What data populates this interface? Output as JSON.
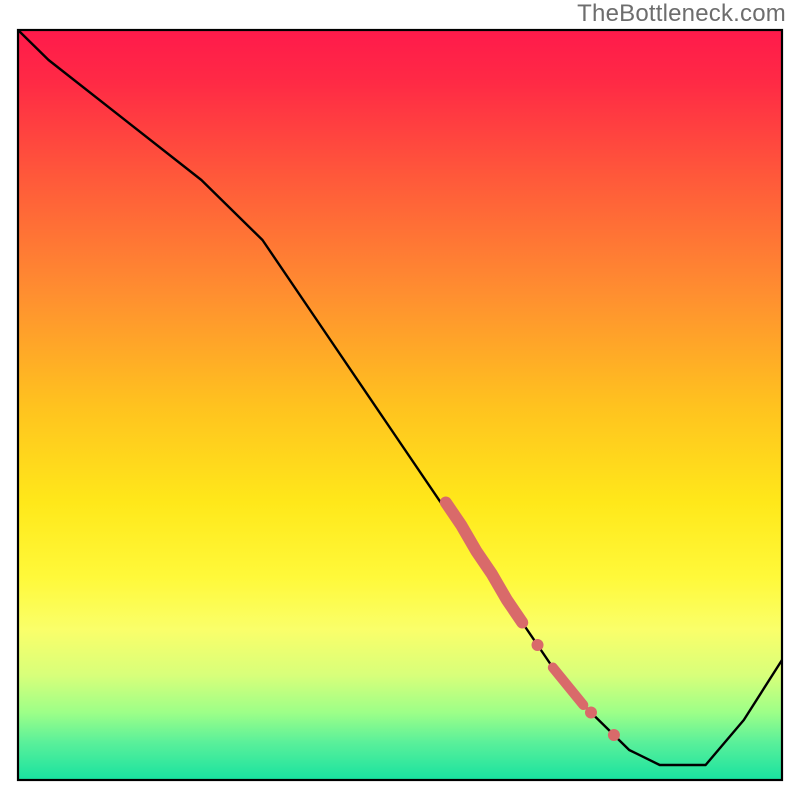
{
  "watermark": "TheBottleneck.com",
  "chart_data": {
    "type": "line",
    "title": "",
    "xlabel": "",
    "ylabel": "",
    "xlim": [
      0,
      100
    ],
    "ylim": [
      0,
      100
    ],
    "background_gradient": {
      "stops": [
        {
          "offset": 0.0,
          "color": "#ff1a4b"
        },
        {
          "offset": 0.07,
          "color": "#ff2a45"
        },
        {
          "offset": 0.2,
          "color": "#ff5a3a"
        },
        {
          "offset": 0.35,
          "color": "#ff8e30"
        },
        {
          "offset": 0.5,
          "color": "#ffc21f"
        },
        {
          "offset": 0.63,
          "color": "#ffe81a"
        },
        {
          "offset": 0.73,
          "color": "#fff93a"
        },
        {
          "offset": 0.8,
          "color": "#faff6a"
        },
        {
          "offset": 0.86,
          "color": "#d8ff7a"
        },
        {
          "offset": 0.91,
          "color": "#9dff88"
        },
        {
          "offset": 0.95,
          "color": "#5af09a"
        },
        {
          "offset": 1.0,
          "color": "#18e2a0"
        }
      ]
    },
    "series": [
      {
        "name": "bottleneck-curve",
        "color": "#000000",
        "x": [
          0,
          4,
          24,
          32,
          40,
          48,
          56,
          62,
          66,
          70,
          73,
          76,
          80,
          84,
          90,
          95,
          100
        ],
        "y": [
          100,
          96,
          80,
          72,
          60,
          48,
          36,
          27,
          21,
          15,
          11,
          8,
          4,
          2,
          2,
          8,
          16
        ]
      }
    ],
    "highlight_segments": [
      {
        "name": "thick-segment-upper",
        "color": "#d96a6a",
        "width": 12,
        "x": [
          56,
          58,
          60,
          62,
          64,
          66
        ],
        "y": [
          37,
          34,
          30.5,
          27.5,
          24,
          21
        ]
      },
      {
        "name": "thick-segment-lower",
        "color": "#d96a6a",
        "width": 10,
        "x": [
          70,
          72,
          74
        ],
        "y": [
          15,
          12.5,
          10
        ]
      }
    ],
    "highlight_points": [
      {
        "name": "dot-middle",
        "x": 68,
        "y": 18,
        "r": 6,
        "color": "#d96a6a"
      },
      {
        "name": "dot-lower-end",
        "x": 75,
        "y": 9,
        "r": 6,
        "color": "#d96a6a"
      },
      {
        "name": "dot-near-bottom",
        "x": 78,
        "y": 6,
        "r": 6,
        "color": "#d96a6a"
      }
    ],
    "frame": {
      "top": true,
      "right": true,
      "bottom": true,
      "left": true,
      "color": "#000000"
    }
  }
}
